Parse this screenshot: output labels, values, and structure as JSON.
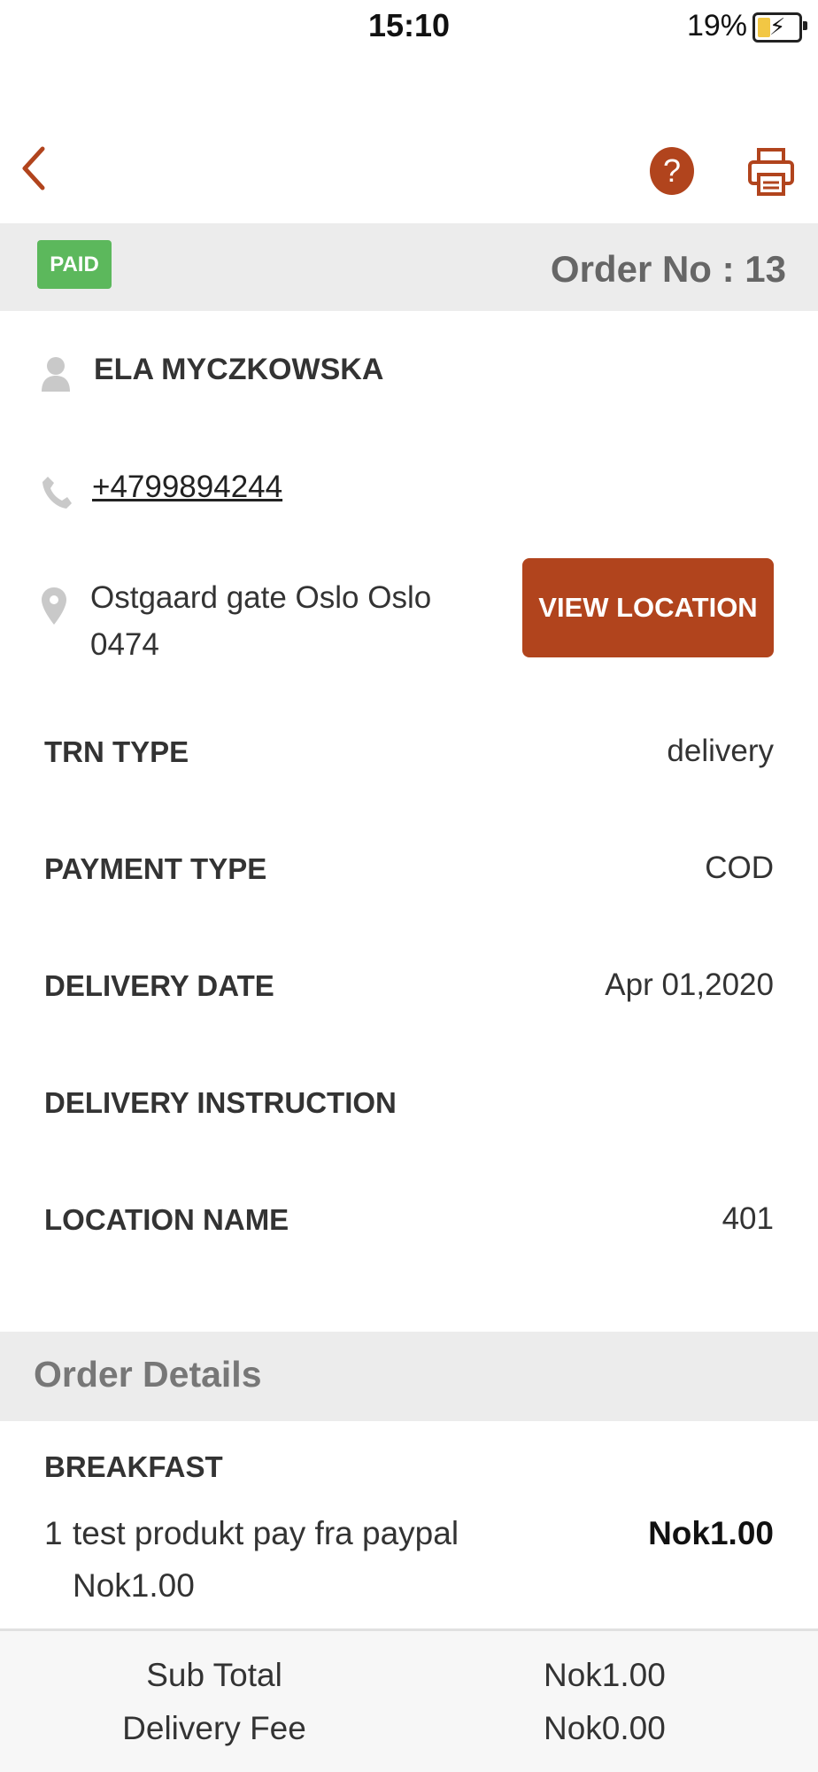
{
  "status_bar": {
    "time": "15:10",
    "battery_percent": "19%"
  },
  "nav": {
    "back_icon": "chevron-left-icon",
    "help_label": "?",
    "print_icon": "printer-icon"
  },
  "order": {
    "payment_status": "PAID",
    "order_no_label": "Order No : 13"
  },
  "customer": {
    "name": "ELA MYCZKOWSKA",
    "phone": "+4799894244",
    "address_line1": "Ostgaard gate Oslo Oslo",
    "address_line2": "0474",
    "view_location_label": "VIEW LOCATION"
  },
  "details": [
    {
      "label": "TRN TYPE",
      "value": "delivery"
    },
    {
      "label": "PAYMENT TYPE",
      "value": "COD"
    },
    {
      "label": "DELIVERY DATE",
      "value": "Apr 01,2020"
    },
    {
      "label": "DELIVERY INSTRUCTION",
      "value": ""
    },
    {
      "label": "LOCATION NAME",
      "value": "401"
    }
  ],
  "order_details": {
    "title": "Order Details",
    "category": "BREAKFAST",
    "items": [
      {
        "qty": "1",
        "name": "test produkt pay fra paypal",
        "unit_price": "Nok1.00",
        "total": "Nok1.00"
      }
    ]
  },
  "summary": {
    "sub_total_label": "Sub Total",
    "sub_total_value": "Nok1.00",
    "delivery_fee_label": "Delivery Fee",
    "delivery_fee_value": "Nok0.00"
  },
  "colors": {
    "accent": "#b1441d",
    "paid_badge": "#5cb85c",
    "band": "#ececec"
  }
}
